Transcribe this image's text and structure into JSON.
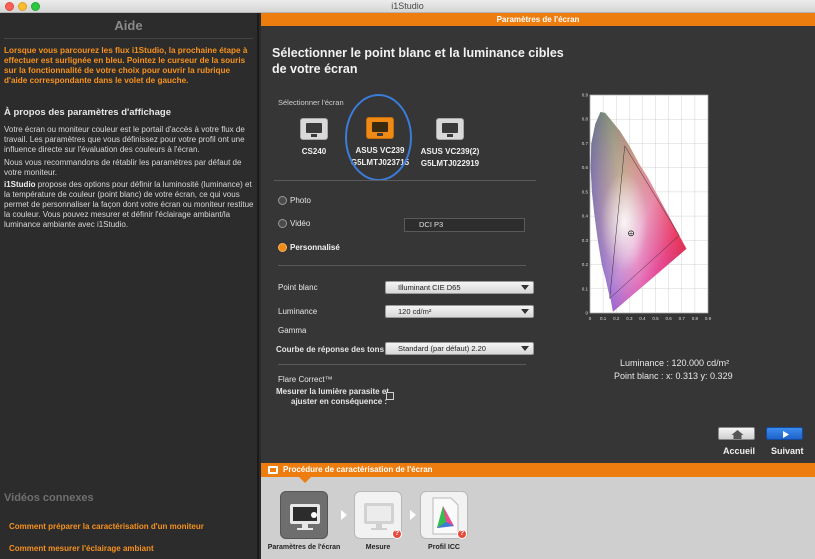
{
  "window": {
    "title": "i1Studio"
  },
  "help": {
    "title": "Aide",
    "intro": "Lorsque vous parcourez les flux i1Studio, la prochaine étape à effectuer est surlignée en bleu. Pointez le curseur de la souris sur la fonctionnalité de votre choix pour ouvrir la rubrique d'aide correspondante dans le volet de gauche.",
    "heading": "À propos des paramètres d'affichage",
    "p1": "Votre écran ou moniteur couleur est le portail d'accès à votre flux de travail. Les paramètres que vous définissez pour votre profil ont une influence directe sur l'évaluation des couleurs à l'écran.",
    "p2": "Nous vous recommandons de rétablir les paramètres par défaut de votre moniteur.",
    "p3_bold": "i1Studio",
    "p3": " propose des options pour définir la luminosité (luminance) et la température de couleur (point blanc) de votre écran, ce qui vous permet de personnaliser la façon dont votre écran ou moniteur restitue la couleur. Vous pouvez mesurer et définir l'éclairage ambiant/la luminance ambiante avec i1Studio.",
    "videos_title": "Vidéos connexes",
    "video_links": [
      "Comment préparer la caractérisation d'un moniteur",
      "Comment mesurer l'éclairage ambiant"
    ]
  },
  "main": {
    "header": "Paramètres de l'écran",
    "title": "Sélectionner le point blanc et la luminance cibles de votre écran",
    "select_display_label": "Sélectionner l'écran",
    "monitors": [
      {
        "name": "CS240",
        "serial": "",
        "selected": false
      },
      {
        "name": "ASUS VC239",
        "serial": "G5LMTJ023715",
        "selected": true
      },
      {
        "name": "ASUS VC239(2)",
        "serial": "G5LMTJ022919",
        "selected": false
      }
    ],
    "radios": {
      "photo": "Photo",
      "video": "Vidéo",
      "custom": "Personnalisé",
      "selected": "custom"
    },
    "video_standard": "DCI P3",
    "white_point_label": "Point blanc",
    "white_point_value": "Illuminant CIE D65",
    "luminance_label": "Luminance",
    "luminance_value": "120 cd/m²",
    "gamma_label": "Gamma",
    "tone_curve_label": "Courbe de réponse des tons :",
    "tone_curve_value": "Standard (par défaut) 2.20",
    "flare_label": "Flare Correct™",
    "flare_measure_line1": "Mesurer la lumière parasite et",
    "flare_measure_line2": "ajuster en conséquence :",
    "flare_checked": false,
    "luminance_readout": "Luminance : 120.000 cd/m²",
    "white_point_readout": "Point blanc : x: 0.313  y: 0.329",
    "nav": {
      "home": "Accueil",
      "next": "Suivant"
    }
  },
  "chart_data": {
    "type": "scatter",
    "title": "",
    "xlim": [
      0,
      0.9
    ],
    "ylim": [
      0,
      0.9
    ],
    "x_ticks": [
      "0",
      "0.1",
      "0.2",
      "0.3",
      "0.4",
      "0.5",
      "0.6",
      "0.7",
      "0.8",
      "0.9"
    ],
    "y_ticks": [
      "0",
      "0.1",
      "0.2",
      "0.3",
      "0.4",
      "0.5",
      "0.6",
      "0.7",
      "0.8",
      "0.9"
    ],
    "grid": true,
    "white_point": {
      "x": 0.313,
      "y": 0.329
    },
    "gamut_triangle": [
      [
        0.68,
        0.32
      ],
      [
        0.265,
        0.69
      ],
      [
        0.15,
        0.06
      ]
    ]
  },
  "workflow": {
    "header": "Procédure de caractérisation de l'écran",
    "steps": [
      {
        "label": "Paramètres de l'écran",
        "active": true
      },
      {
        "label": "Mesure",
        "active": false
      },
      {
        "label": "Profil ICC",
        "active": false
      }
    ]
  },
  "colors": {
    "accent": "#ee7d10",
    "selection_ring": "#3b7bd9",
    "next_button": "#2a74dc"
  }
}
